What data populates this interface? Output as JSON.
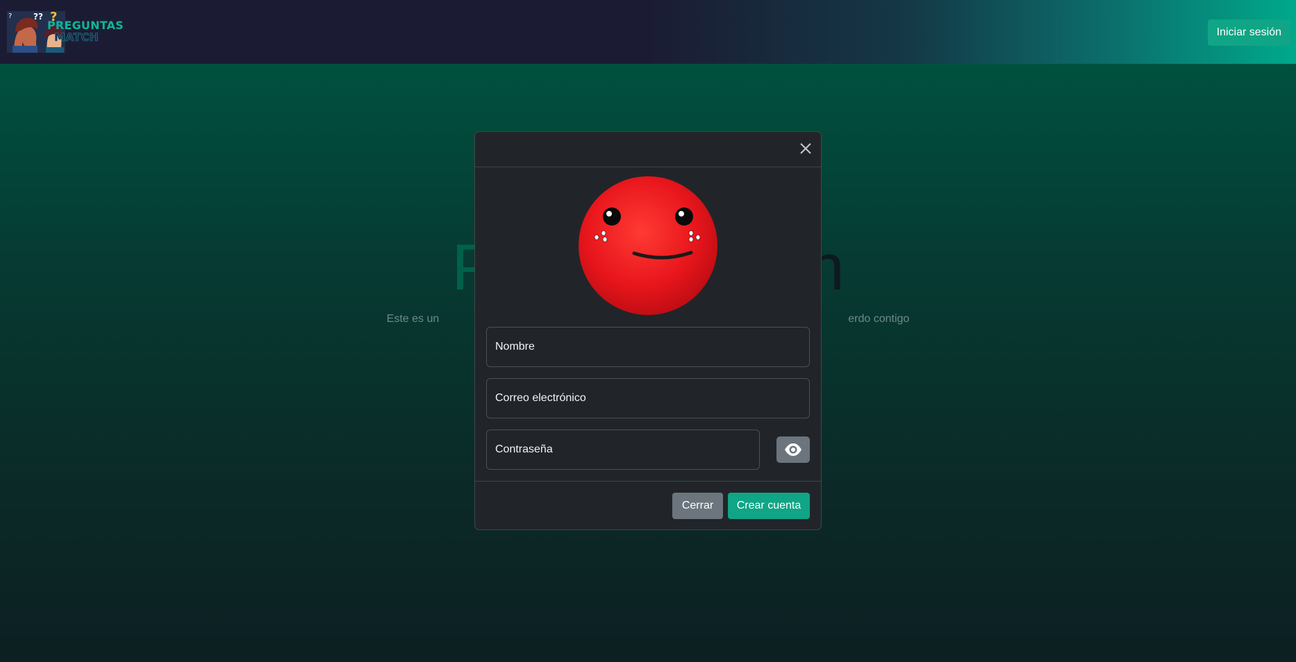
{
  "navbar": {
    "logo_line1": "PREGUNTAS",
    "logo_line2": "MATCH",
    "login_label": "Iniciar sesión"
  },
  "hero": {
    "title_part1": "Pr",
    "title_part2": "ch",
    "subtitle_left": "Este es un",
    "subtitle_right": "erdo contigo"
  },
  "modal": {
    "close_icon": "close-icon",
    "avatar_icon": "smiley-avatar",
    "name_placeholder": "Nombre",
    "email_placeholder": "Correo electrónico",
    "password_placeholder": "Contraseña",
    "eye_icon": "eye-icon",
    "cancel_label": "Cerrar",
    "submit_label": "Crear cuenta"
  },
  "colors": {
    "accent": "#0fa586",
    "modal_bg": "#212529",
    "secondary": "#6c757d",
    "avatar_red": "#e8161c"
  }
}
